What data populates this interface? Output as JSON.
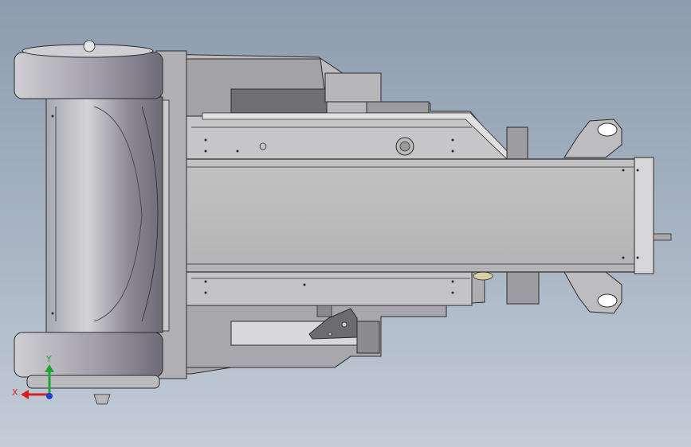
{
  "view": {
    "background_top": "#8d9cae",
    "background_bottom": "#c3ccd7",
    "part_color": "#c9c9c9",
    "part_dark": "#7d7e86",
    "edge_color": "#2b2b2b"
  },
  "triad": {
    "x_label": "X",
    "y_label": "Y",
    "x_color": "#d62020",
    "y_color": "#21a336",
    "z_color": "#1e3fd0"
  }
}
